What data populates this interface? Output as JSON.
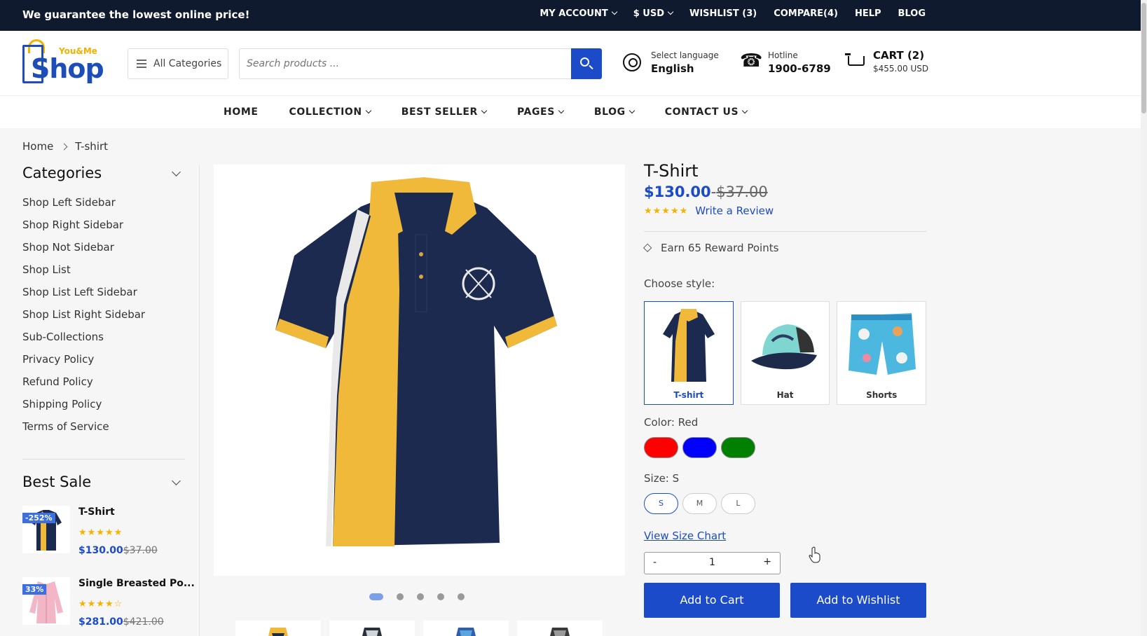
{
  "topbar": {
    "promo": "We guarantee the lowest online price!",
    "links": [
      "MY ACCOUNT",
      "$ USD",
      "WISHLIST (3)",
      "COMPARE(4)",
      "HELP",
      "BLOG"
    ]
  },
  "logo": {
    "small": "You&Me",
    "big": "Shop"
  },
  "header": {
    "all_categories": "All Categories",
    "search_placeholder": "Search products ...",
    "language_label": "Select language",
    "language_value": "English",
    "hotline_label": "Hotline",
    "hotline_value": "1900-6789",
    "cart_label": "CART (2)",
    "cart_total": "$455.00 USD"
  },
  "nav": [
    "HOME",
    "COLLECTION",
    "BEST SELLER",
    "PAGES",
    "BLOG",
    "CONTACT US"
  ],
  "breadcrumb": {
    "home": "Home",
    "current": "T-shirt"
  },
  "sidebar": {
    "categories_title": "Categories",
    "categories": [
      "Shop Left Sidebar",
      "Shop Right Sidebar",
      "Shop Not Sidebar",
      "Shop List",
      "Shop List Left Sidebar",
      "Shop List Right Sidebar",
      "Sub-Collections",
      "Privacy Policy",
      "Refund Policy",
      "Shipping Policy",
      "Terms of Service"
    ],
    "best_sale_title": "Best Sale",
    "best_sale": [
      {
        "badge": "-252%",
        "name": "T-Shirt",
        "stars": "★★★★★",
        "price": "$130.00",
        "old_price": "$37.00"
      },
      {
        "badge": "33%",
        "name": "Single Breasted Po...",
        "stars": "★★★★☆",
        "price": "$281.00",
        "old_price": "$421.00"
      }
    ]
  },
  "product": {
    "title": "T-Shirt",
    "price": "$130.00",
    "dash": "-",
    "old_price": "$37.00",
    "stars": "★★★★★",
    "review_link": "Write a Review",
    "reward": "Earn 65 Reward Points",
    "style_label": "Choose style:",
    "styles": [
      "T-shirt",
      "Hat",
      "Shorts"
    ],
    "color_label": "Color: Red",
    "colors": [
      "#ff0000",
      "#0000ff",
      "#008000"
    ],
    "size_label": "Size: S",
    "sizes": [
      "S",
      "M",
      "L"
    ],
    "size_chart": "View Size Chart",
    "qty_minus": "-",
    "qty_value": "1",
    "qty_plus": "+",
    "add_to_cart": "Add to Cart",
    "add_to_wishlist": "Add to Wishlist"
  },
  "colors": {
    "accent": "#1c4bc9",
    "topbar": "#0f1a2e",
    "star": "#f5b301"
  }
}
